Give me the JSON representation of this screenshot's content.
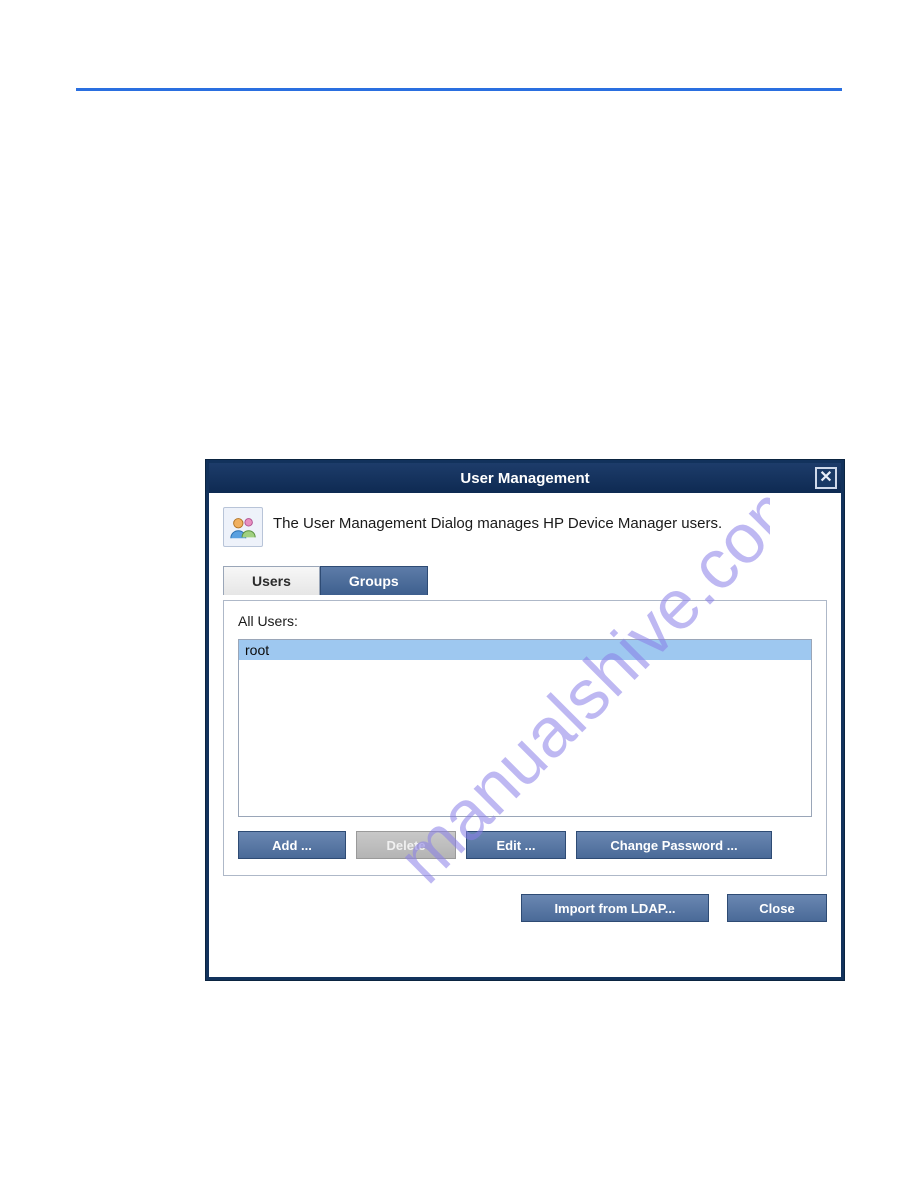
{
  "watermark": "manualshive.com",
  "dialog": {
    "title": "User Management",
    "description": "The User Management Dialog manages HP Device Manager users.",
    "tabs": {
      "users": "Users",
      "groups": "Groups"
    },
    "panel": {
      "label": "All Users:",
      "items": [
        "root"
      ]
    },
    "buttons": {
      "add": "Add ...",
      "delete": "Delete",
      "edit": "Edit ...",
      "change_password": "Change Password ...",
      "import_ldap": "Import from LDAP...",
      "close": "Close"
    }
  }
}
